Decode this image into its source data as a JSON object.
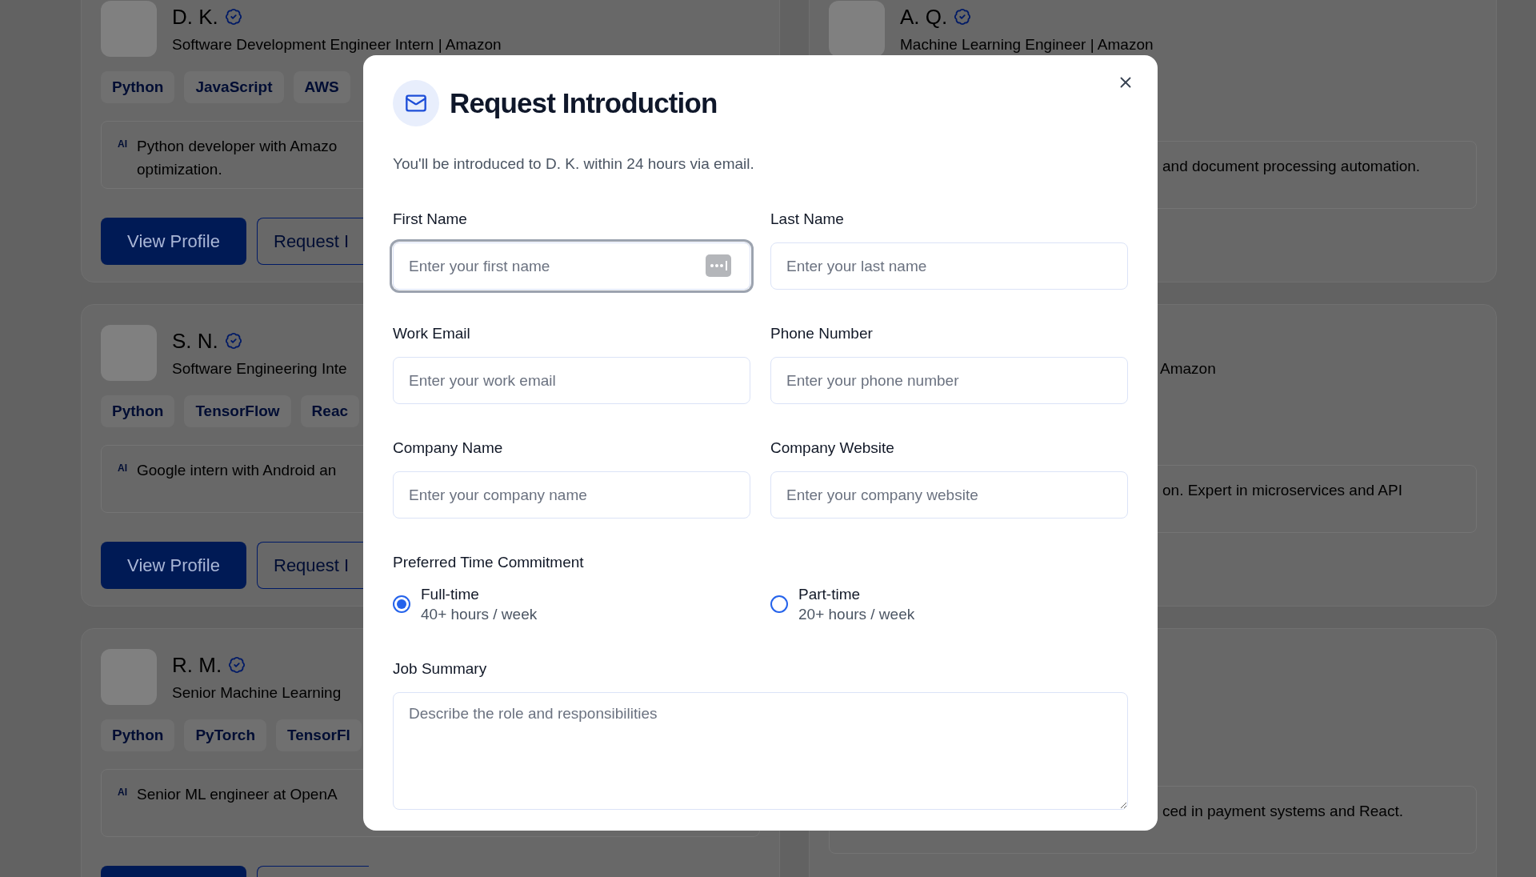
{
  "left_cards": [
    {
      "name": "D. K.",
      "subtitle": "Software Development Engineer Intern | Amazon",
      "tags": [
        "Python",
        "JavaScript",
        "AWS"
      ],
      "ai_badge": "AI",
      "description_lines": [
        "Python developer with Amazo",
        "optimization."
      ],
      "buttons": [
        "View Profile",
        "Request I"
      ]
    },
    {
      "name": "S. N.",
      "subtitle": "Software Engineering Inte",
      "tags": [
        "Python",
        "TensorFlow",
        "Reac"
      ],
      "ai_badge": "AI",
      "description_lines": [
        "Google intern with Android an"
      ],
      "buttons": [
        "View Profile",
        "Request I"
      ]
    },
    {
      "name": "R. M.",
      "subtitle": "Senior Machine Learning",
      "tags": [
        "Python",
        "PyTorch",
        "TensorFl"
      ],
      "ai_badge": "AI",
      "description_lines": [
        "Senior ML engineer at OpenA"
      ]
    }
  ],
  "right_cards": [
    {
      "name": "A. Q.",
      "subtitle": "Machine Learning Engineer | Amazon",
      "description_tail": "and document processing automation."
    },
    {
      "subtitle_tail": "Amazon",
      "description_tail": "on. Expert in microservices and API"
    },
    {
      "description_tail": "ced in payment systems and React."
    }
  ],
  "dialog": {
    "title": "Request Introduction",
    "subtitle": "You'll be introduced to D. K. within 24 hours via email.",
    "fields": [
      {
        "label": "First Name",
        "placeholder": "Enter your first name",
        "focused": true
      },
      {
        "label": "Last Name",
        "placeholder": "Enter your last name",
        "focused": false
      },
      {
        "label": "Work Email",
        "placeholder": "Enter your work email",
        "focused": false
      },
      {
        "label": "Phone Number",
        "placeholder": "Enter your phone number",
        "focused": false
      },
      {
        "label": "Company Name",
        "placeholder": "Enter your company name",
        "focused": false
      },
      {
        "label": "Company Website",
        "placeholder": "Enter your company website",
        "focused": false
      }
    ],
    "time_commitment": {
      "label": "Preferred Time Commitment",
      "options": [
        {
          "title": "Full-time",
          "detail": "40+ hours / week",
          "selected": true
        },
        {
          "title": "Part-time",
          "detail": "20+ hours / week",
          "selected": false
        }
      ]
    },
    "job_summary": {
      "label": "Job Summary",
      "placeholder": "Describe the role and responsibilities"
    }
  }
}
